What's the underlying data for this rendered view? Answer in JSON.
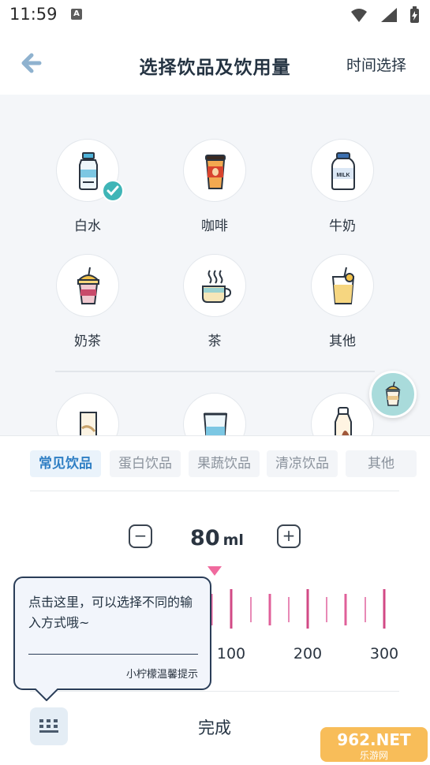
{
  "status_bar": {
    "time": "11:59",
    "notification_letter": "A"
  },
  "header": {
    "title": "选择饮品及饮用量",
    "right_action": "时间选择"
  },
  "drinks": [
    {
      "label": "白水",
      "icon": "water-bottle-icon",
      "selected": true
    },
    {
      "label": "咖啡",
      "icon": "coffee-cup-icon",
      "selected": false
    },
    {
      "label": "牛奶",
      "icon": "milk-bottle-icon",
      "selected": false
    },
    {
      "label": "奶茶",
      "icon": "milk-tea-icon",
      "selected": false
    },
    {
      "label": "茶",
      "icon": "tea-cup-icon",
      "selected": false
    },
    {
      "label": "其他",
      "icon": "drink-glass-icon",
      "selected": false
    }
  ],
  "more_drinks_icons": [
    "milk-carton-icon",
    "glass-icon",
    "bottle-icon"
  ],
  "category_tabs": [
    {
      "label": "常见饮品",
      "active": true
    },
    {
      "label": "蛋白饮品",
      "active": false
    },
    {
      "label": "果蔬饮品",
      "active": false
    },
    {
      "label": "清凉饮品",
      "active": false
    },
    {
      "label": "其他",
      "active": false
    }
  ],
  "amount": {
    "value": "80",
    "unit": "ml",
    "minus": "−",
    "plus": "+"
  },
  "ruler": {
    "labels": [
      "100",
      "200",
      "300"
    ],
    "accent": "#e0609a"
  },
  "tooltip": {
    "text": "点击这里，可以选择不同的输入方式哦~",
    "signature": "小柠檬温馨提示"
  },
  "footer": {
    "done_label": "完成"
  },
  "watermark": {
    "text": "962.NET",
    "subtext": "乐游网"
  },
  "colors": {
    "primary": "#3fb5b7",
    "tab_active": "#2f7fc4",
    "title": "#243342"
  }
}
